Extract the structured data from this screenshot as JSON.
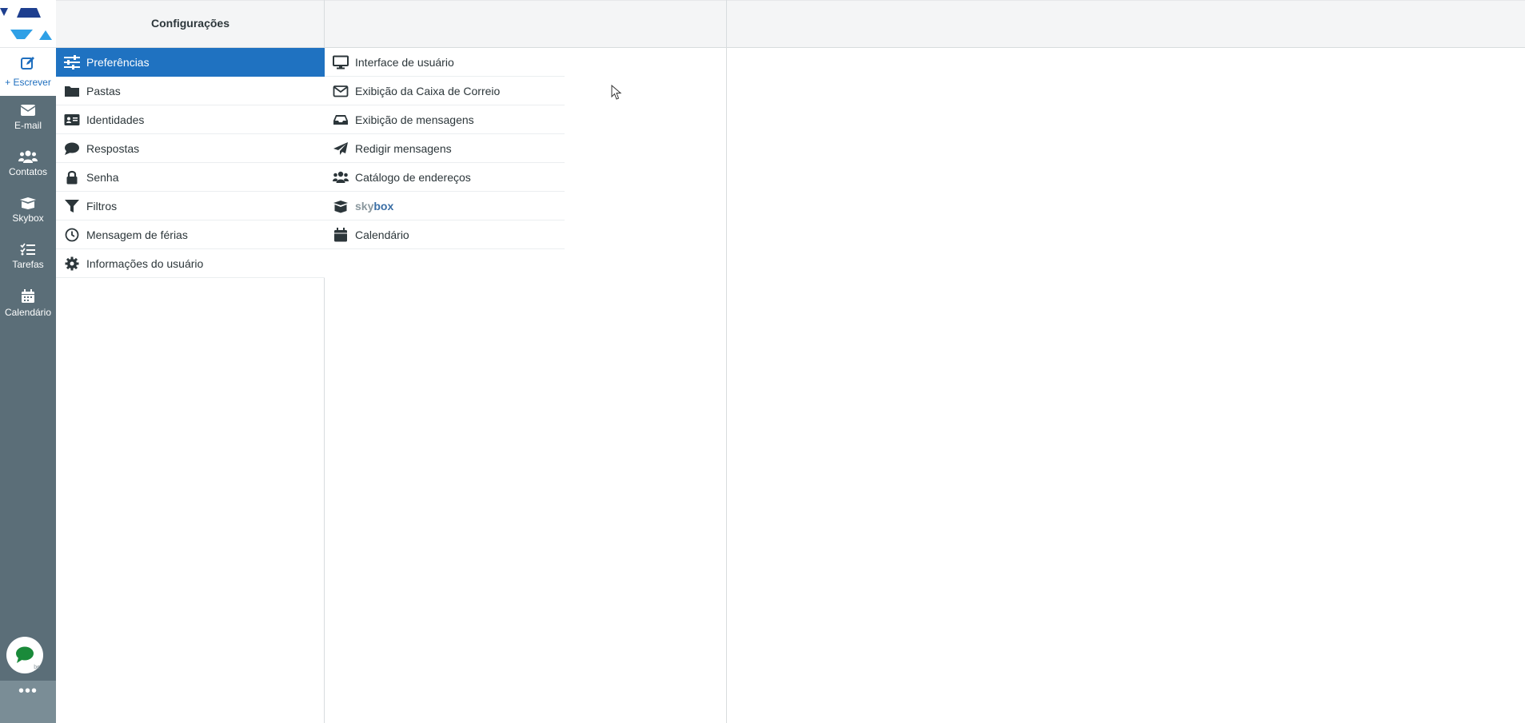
{
  "header": {
    "title": "Configurações"
  },
  "rail": {
    "compose_label": "+ Escrever",
    "items": [
      {
        "label": "E-mail",
        "icon": "envelope-icon"
      },
      {
        "label": "Contatos",
        "icon": "users-icon"
      },
      {
        "label": "Skybox",
        "icon": "box-icon"
      },
      {
        "label": "Tarefas",
        "icon": "tasks-icon"
      },
      {
        "label": "Calendário",
        "icon": "calendar-icon"
      }
    ],
    "more_label": "•••",
    "chat_badge": "be"
  },
  "settings_sections": [
    {
      "label": "Preferências",
      "icon": "sliders-icon",
      "active": true
    },
    {
      "label": "Pastas",
      "icon": "folder-icon"
    },
    {
      "label": "Identidades",
      "icon": "id-card-icon"
    },
    {
      "label": "Respostas",
      "icon": "comment-icon"
    },
    {
      "label": "Senha",
      "icon": "lock-icon"
    },
    {
      "label": "Filtros",
      "icon": "filter-icon"
    },
    {
      "label": "Mensagem de férias",
      "icon": "clock-icon"
    },
    {
      "label": "Informações do usuário",
      "icon": "gear-icon"
    }
  ],
  "preferences_sections": [
    {
      "label": "Interface de usuário",
      "icon": "monitor-icon"
    },
    {
      "label": "Exibição da Caixa de Correio",
      "icon": "envelope-icon"
    },
    {
      "label": "Exibição de mensagens",
      "icon": "inbox-icon"
    },
    {
      "label": "Redigir mensagens",
      "icon": "paper-plane-icon"
    },
    {
      "label": "Catálogo de endereços",
      "icon": "users-icon"
    },
    {
      "label_part1": "sky",
      "label_part2": "box",
      "icon": "box-icon"
    },
    {
      "label": "Calendário",
      "icon": "calendar-icon"
    }
  ],
  "colors": {
    "rail": "#5b6e78",
    "accent": "#1f72c1",
    "logo_dark": "#1e3f8f",
    "logo_light": "#2fa0e6"
  }
}
